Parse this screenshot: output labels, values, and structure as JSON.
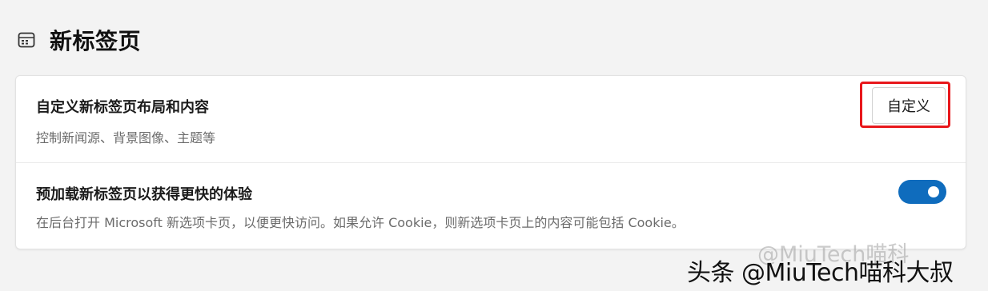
{
  "header": {
    "icon": "new-tab-icon",
    "title": "新标签页"
  },
  "settings": {
    "customize": {
      "title": "自定义新标签页布局和内容",
      "description": "控制新闻源、背景图像、主题等",
      "button_label": "自定义",
      "highlight_color": "#e8171b"
    },
    "preload": {
      "title": "预加载新标签页以获得更快的体验",
      "description": "在后台打开 Microsoft 新选项卡页，以便更快访问。如果允许 Cookie，则新选项卡页上的内容可能包括 Cookie。",
      "toggle_state": "on",
      "toggle_color": "#0f6cbd"
    }
  },
  "watermark": {
    "text": "头条 @MiuTech喵科大叔",
    "ghost_text": "@MiuTech喵科"
  }
}
